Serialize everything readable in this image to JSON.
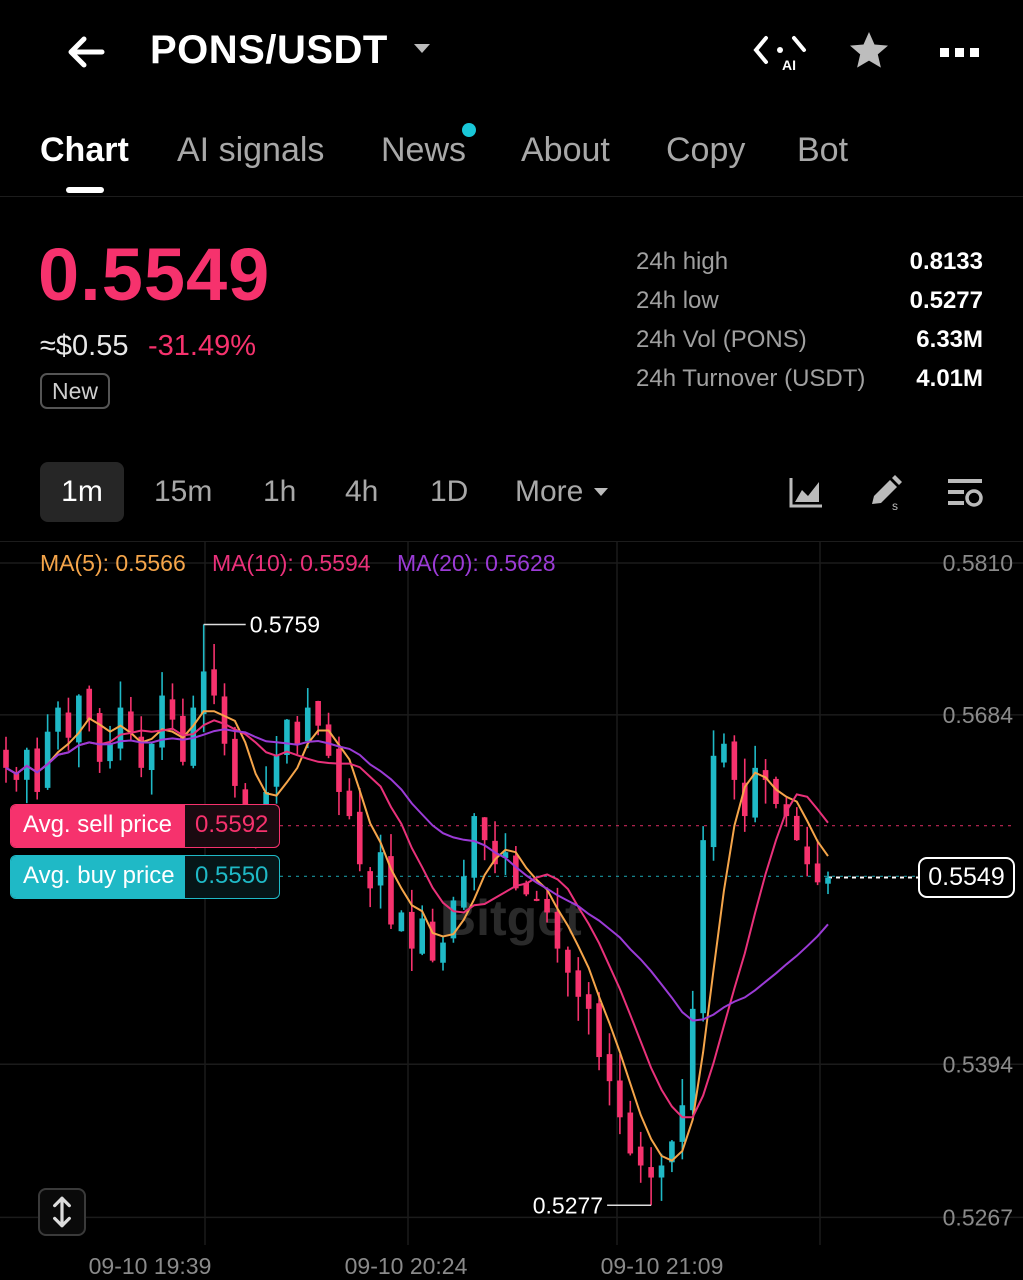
{
  "header": {
    "pair": "PONS/USDT",
    "ai_icon_text": "AI"
  },
  "tabs": [
    {
      "label": "Chart",
      "active": true
    },
    {
      "label": "AI signals"
    },
    {
      "label": "News",
      "has_dot": true
    },
    {
      "label": "About"
    },
    {
      "label": "Copy"
    },
    {
      "label": "Bot"
    }
  ],
  "ticker": {
    "last_price": "0.5549",
    "approx_usd": "≈$0.55",
    "change": "-31.49%",
    "badge": "New"
  },
  "stats": [
    {
      "label": "24h high",
      "value": "0.8133"
    },
    {
      "label": "24h low",
      "value": "0.5277"
    },
    {
      "label": "24h Vol (PONS)",
      "value": "6.33M"
    },
    {
      "label": "24h Turnover (USDT)",
      "value": "4.01M"
    }
  ],
  "intervals": {
    "items": [
      "1m",
      "15m",
      "1h",
      "4h",
      "1D"
    ],
    "active": "1m",
    "more": "More"
  },
  "indicators": {
    "ma5": "MA(5): 0.5566",
    "ma10": "MA(10): 0.5594",
    "ma20": "MA(20): 0.5628"
  },
  "avg_prices": {
    "sell_label": "Avg. sell price",
    "sell_value": "0.5592",
    "buy_label": "Avg. buy price",
    "buy_value": "0.5550"
  },
  "watermark": "Bitget",
  "colors": {
    "up": "#1fb9c6",
    "down": "#f6326d",
    "ma5": "#f5a54a",
    "ma10": "#e9317a",
    "ma20": "#9b3bd6",
    "price_accent": "#f6326d"
  },
  "chart_data": {
    "type": "candlestick",
    "interval": "1m",
    "y_ticks": [
      0.581,
      0.5684,
      0.5394,
      0.5267
    ],
    "x_ticks": [
      "09-10 19:39",
      "09-10 20:24",
      "09-10 21:09"
    ],
    "ylim": [
      0.5249,
      0.581
    ],
    "current_price": 0.5549,
    "high_marker": {
      "value": 0.5759,
      "label": "0.5759"
    },
    "low_marker": {
      "value": 0.5277,
      "label": "0.5277"
    },
    "avg_sell_price": 0.5592,
    "avg_buy_price": 0.555,
    "grid": true,
    "close_series": [
      0.564,
      0.563,
      0.5655,
      0.562,
      0.567,
      0.569,
      0.5665,
      0.57,
      0.568,
      0.5645,
      0.566,
      0.569,
      0.567,
      0.564,
      0.566,
      0.57,
      0.568,
      0.5645,
      0.569,
      0.572,
      0.57,
      0.566,
      0.5625,
      0.56,
      0.559,
      0.562,
      0.565,
      0.568,
      0.566,
      0.569,
      0.5675,
      0.565,
      0.562,
      0.56,
      0.556,
      0.554,
      0.557,
      0.551,
      0.552,
      0.549,
      0.5515,
      0.548,
      0.5495,
      0.553,
      0.555,
      0.56,
      0.558,
      0.556,
      0.557,
      0.554,
      0.5535,
      0.553,
      0.552,
      0.549,
      0.547,
      0.545,
      0.544,
      0.54,
      0.538,
      0.535,
      0.532,
      0.531,
      0.53,
      0.531,
      0.533,
      0.536,
      0.544,
      0.558,
      0.565,
      0.566,
      0.563,
      0.56,
      0.564,
      0.563,
      0.561,
      0.56,
      0.558,
      0.556,
      0.5545,
      0.5549
    ]
  }
}
